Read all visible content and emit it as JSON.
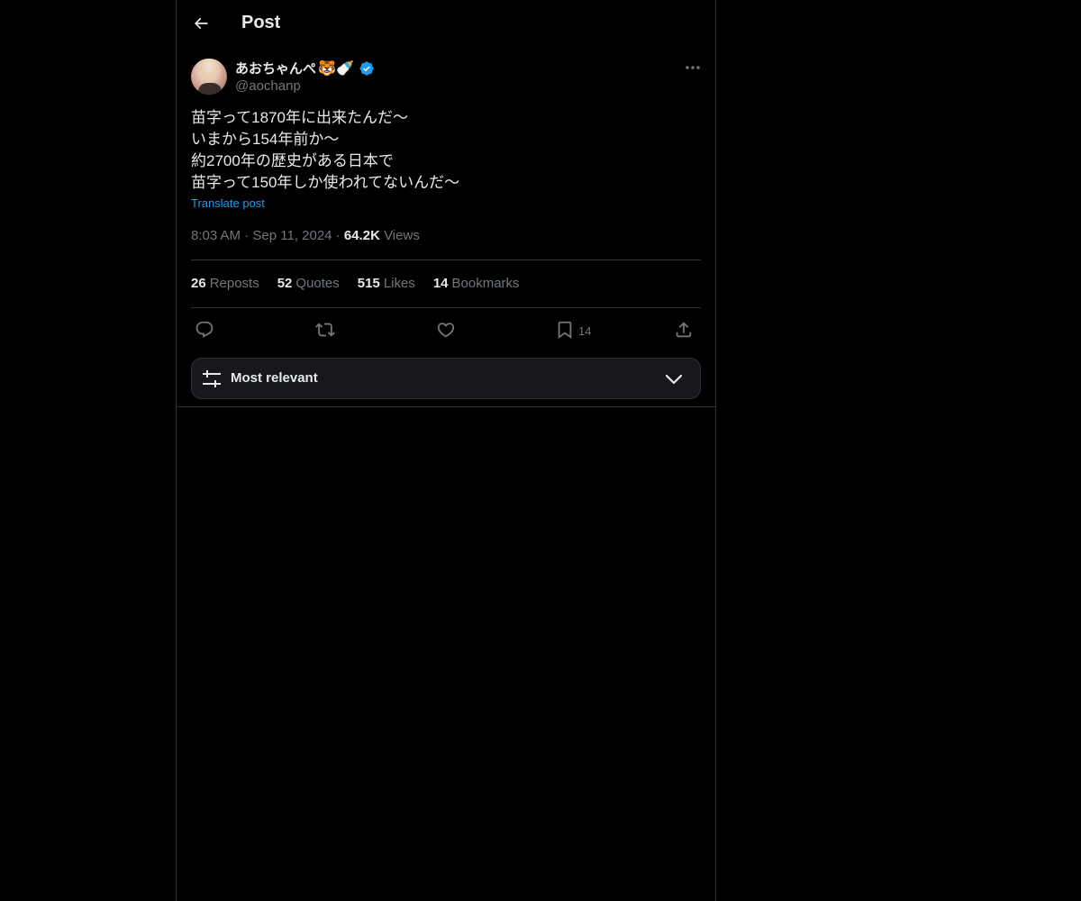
{
  "header": {
    "title": "Post"
  },
  "author": {
    "name": "あおちゃんぺ",
    "name_emoji": "🐯🍼",
    "handle": "@aochanp",
    "verified": true,
    "avatar": "avatar-photo"
  },
  "post": {
    "lines": [
      "苗字って1870年に出来たんだ〜",
      "いまから154年前か〜",
      "約2700年の歴史がある日本で",
      "苗字って150年しか使われてないんだ〜"
    ],
    "translate_label": "Translate post",
    "time": "8:03 AM",
    "date": "Sep 11, 2024",
    "separator": "·",
    "views_count": "64.2K",
    "views_label": "Views"
  },
  "stats": {
    "reposts_count": "26",
    "reposts_label": "Reposts",
    "quotes_count": "52",
    "quotes_label": "Quotes",
    "likes_count": "515",
    "likes_label": "Likes",
    "bookmarks_count": "14",
    "bookmarks_label": "Bookmarks"
  },
  "actions": {
    "reply_icon": "reply-icon",
    "repost_icon": "repost-icon",
    "like_icon": "heart-icon",
    "bookmark_icon": "bookmark-icon",
    "bookmark_count": "14",
    "share_icon": "share-icon"
  },
  "sort": {
    "label": "Most relevant",
    "icon": "sliders-icon",
    "chevron": "chevron-down-icon"
  },
  "colors": {
    "background": "#000000",
    "text": "#e7e9ea",
    "muted": "#71767b",
    "accent": "#1d9bf0",
    "border": "#2f3336"
  }
}
